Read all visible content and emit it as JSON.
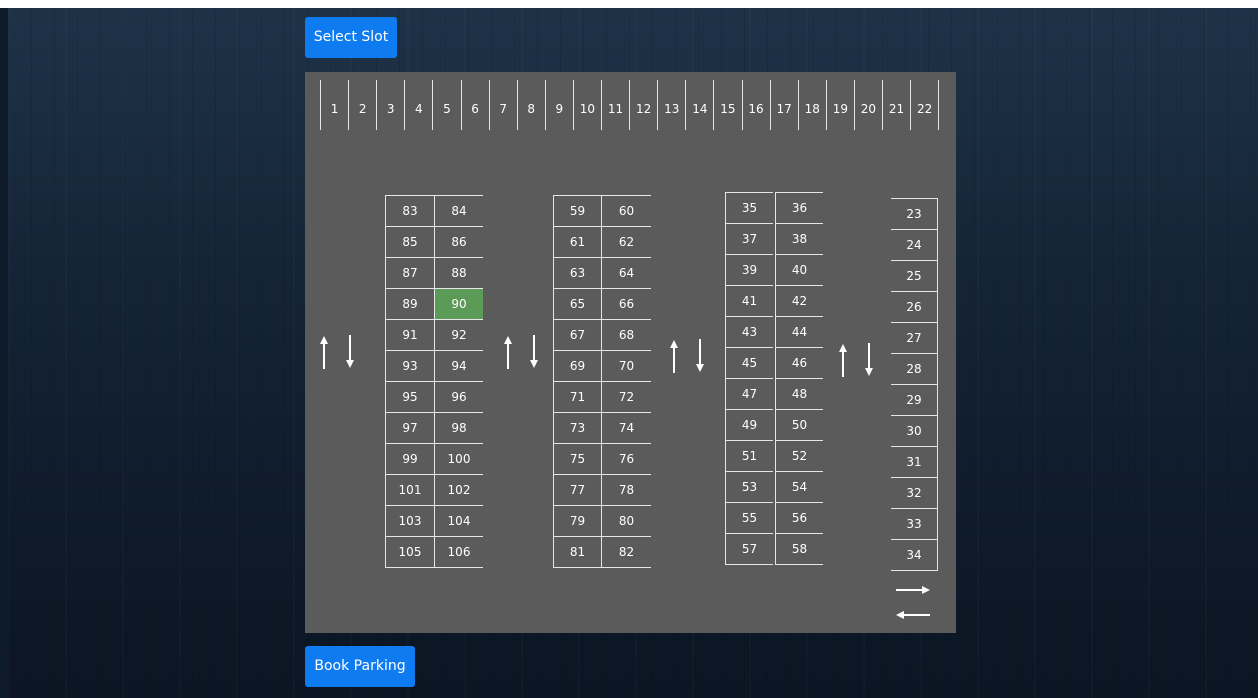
{
  "buttons": {
    "select_slot": "Select Slot",
    "book_parking": "Book Parking"
  },
  "colors": {
    "lot": "#5b5b5b",
    "selected_slot": "#5c9a58",
    "button": "#0f7bf0"
  },
  "selected_slot": "90",
  "top_row": [
    "1",
    "2",
    "3",
    "4",
    "5",
    "6",
    "7",
    "8",
    "9",
    "10",
    "11",
    "12",
    "13",
    "14",
    "15",
    "16",
    "17",
    "18",
    "19",
    "20",
    "21",
    "22"
  ],
  "block_a_left": [
    "83",
    "85",
    "87",
    "89",
    "91",
    "93",
    "95",
    "97",
    "99",
    "101",
    "103",
    "105"
  ],
  "block_a_right": [
    "84",
    "86",
    "88",
    "90",
    "92",
    "94",
    "96",
    "98",
    "100",
    "102",
    "104",
    "106"
  ],
  "block_b_left": [
    "59",
    "61",
    "63",
    "65",
    "67",
    "69",
    "71",
    "73",
    "75",
    "77",
    "79",
    "81"
  ],
  "block_b_right": [
    "60",
    "62",
    "64",
    "66",
    "68",
    "70",
    "72",
    "74",
    "76",
    "78",
    "80",
    "82"
  ],
  "block_c_left": [
    "35",
    "37",
    "39",
    "41",
    "43",
    "45",
    "47",
    "49",
    "51",
    "53",
    "55",
    "57"
  ],
  "block_c_right": [
    "36",
    "38",
    "40",
    "42",
    "44",
    "46",
    "48",
    "50",
    "52",
    "54",
    "56",
    "58"
  ],
  "right_column": [
    "23",
    "24",
    "25",
    "26",
    "27",
    "28",
    "29",
    "30",
    "31",
    "32",
    "33",
    "34"
  ],
  "icons": {
    "lane": "two-way-vertical-arrows-icon",
    "exit": "two-way-horizontal-arrows-icon"
  }
}
